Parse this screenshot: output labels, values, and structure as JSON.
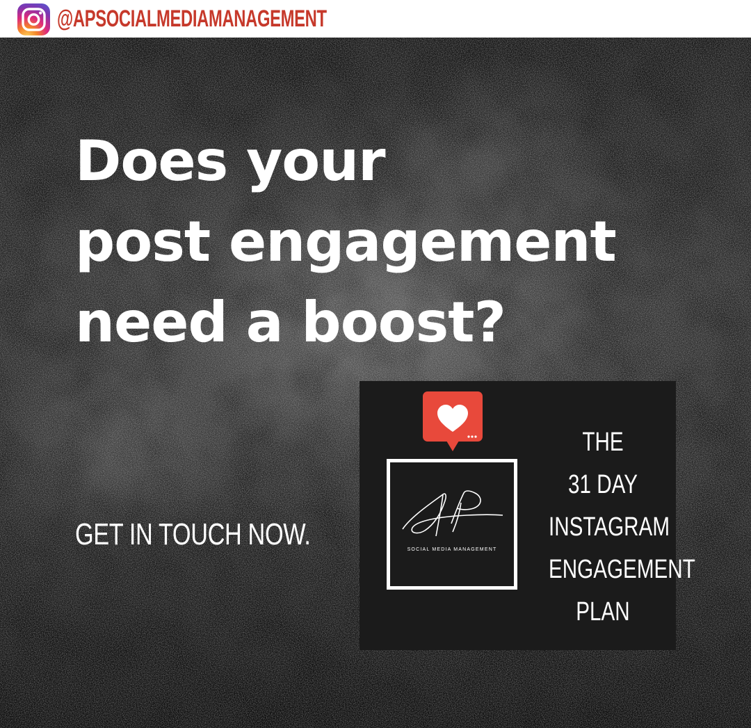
{
  "header": {
    "handle": "@APSOCIALMEDIAMANAGEMENT",
    "icon": "instagram-icon",
    "handle_color": "#c6392b"
  },
  "poster": {
    "headline_lines": [
      "Does your",
      "post engagement",
      "need a boost?"
    ],
    "cta": "GET IN TOUCH NOW."
  },
  "card": {
    "heart_icon": "heart-notification-icon",
    "heart_color": "#e8493b",
    "logo_subtitle": "SOCIAL MEDIA MANAGEMENT",
    "plan_lines": [
      "THE",
      "31 DAY",
      "INSTAGRAM",
      "ENGAGEMENT",
      "PLAN"
    ]
  }
}
